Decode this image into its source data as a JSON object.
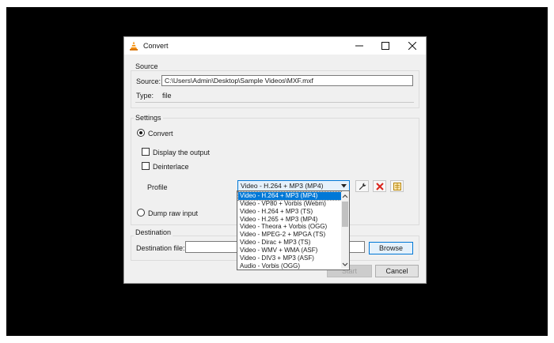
{
  "window": {
    "title": "Convert",
    "controls": [
      "minimize-icon",
      "maximize-icon",
      "close-icon"
    ]
  },
  "source": {
    "group_label": "Source",
    "source_label": "Source:",
    "source_value": "C:\\Users\\Admin\\Desktop\\Sample Videos\\MXF.mxf",
    "type_label": "Type:",
    "type_value": "file"
  },
  "settings": {
    "group_label": "Settings",
    "convert_label": "Convert",
    "display_output_label": "Display the output",
    "deinterlace_label": "Deinterlace",
    "profile_label": "Profile",
    "profile_selected": "Video - H.264 + MP3 (MP4)",
    "dump_raw_label": "Dump raw input",
    "profile_tools": [
      "wrench-icon",
      "delete-icon",
      "new-profile-icon"
    ]
  },
  "profile_options": [
    "Video - H.264 + MP3 (MP4)",
    "Video - VP80 + Vorbis (Webm)",
    "Video - H.264 + MP3 (TS)",
    "Video - H.265 + MP3 (MP4)",
    "Video - Theora + Vorbis (OGG)",
    "Video - MPEG-2 + MPGA (TS)",
    "Video - Dirac + MP3 (TS)",
    "Video - WMV + WMA (ASF)",
    "Video - DIV3 + MP3 (ASF)",
    "Audio - Vorbis (OGG)"
  ],
  "destination": {
    "group_label": "Destination",
    "file_label": "Destination file:",
    "file_value": "",
    "browse_label": "Browse"
  },
  "footer": {
    "start_label": "Start",
    "cancel_label": "Cancel"
  },
  "colors": {
    "accent": "#0078d7",
    "window_bg": "#f0f0f0",
    "backdrop": "#000000"
  }
}
